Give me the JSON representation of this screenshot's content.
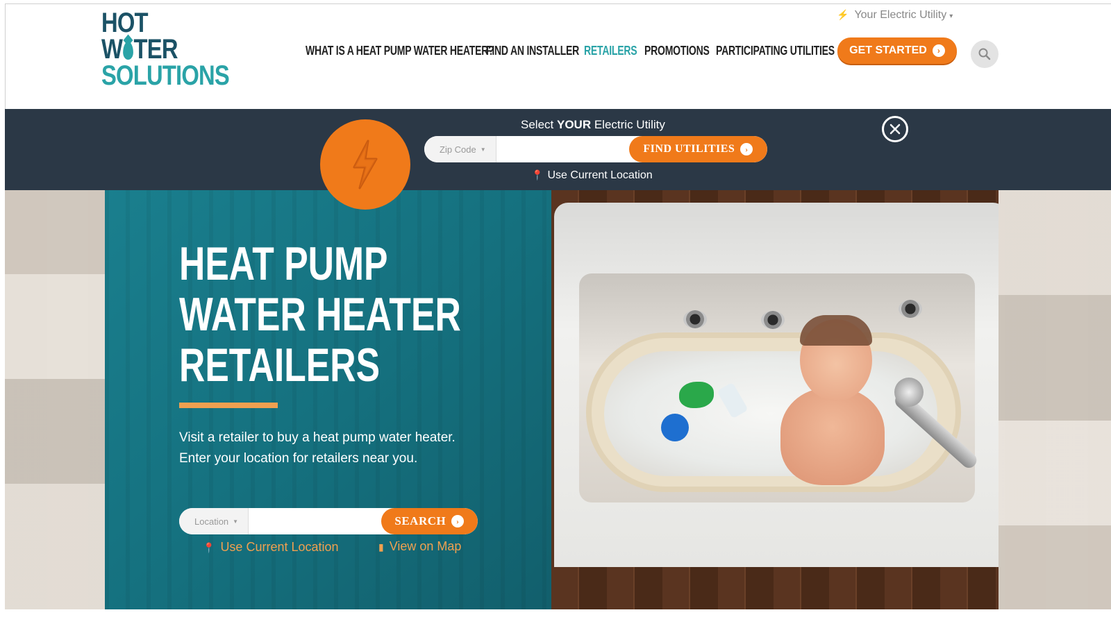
{
  "header": {
    "logo": {
      "line1": "HOT",
      "line2a": "W",
      "line2b": "TER",
      "line3": "SOLUTIONS"
    },
    "utility_link": "Your Electric Utility",
    "nav": [
      {
        "label": "WHAT IS A HEAT PUMP WATER HEATER?",
        "active": false
      },
      {
        "label": "FIND AN INSTALLER",
        "active": false
      },
      {
        "label": "RETAILERS",
        "active": true
      },
      {
        "label": "PROMOTIONS",
        "active": false
      },
      {
        "label": "PARTICIPATING UTILITIES",
        "active": false
      }
    ],
    "cta_label": "GET STARTED"
  },
  "utility_bar": {
    "label_pre": "Select ",
    "label_bold": "YOUR",
    "label_post": " Electric Utility",
    "zip_select": "Zip Code",
    "zip_value": "",
    "find_label": "FIND UTILITIES",
    "use_location": "Use Current Location"
  },
  "hero": {
    "title_lines": [
      "HEAT PUMP",
      "WATER HEATER",
      "RETAILERS"
    ],
    "description": "Visit a retailer to buy a heat pump water heater. Enter your location for retailers near you.",
    "location_select": "Location",
    "location_value": "",
    "search_label": "SEARCH",
    "use_location": "Use Current Location",
    "view_map": "View on Map"
  },
  "colors": {
    "brand_dark": "#1b5266",
    "brand_teal": "#2aa3a7",
    "accent_orange": "#f07a1a",
    "utility_bar_bg": "#2b3846",
    "hero_teal": "#15717f"
  },
  "icons": [
    "bolt-icon",
    "caret-down-icon",
    "search-icon",
    "close-icon",
    "location-pin-icon",
    "map-icon",
    "arrow-right-icon"
  ]
}
